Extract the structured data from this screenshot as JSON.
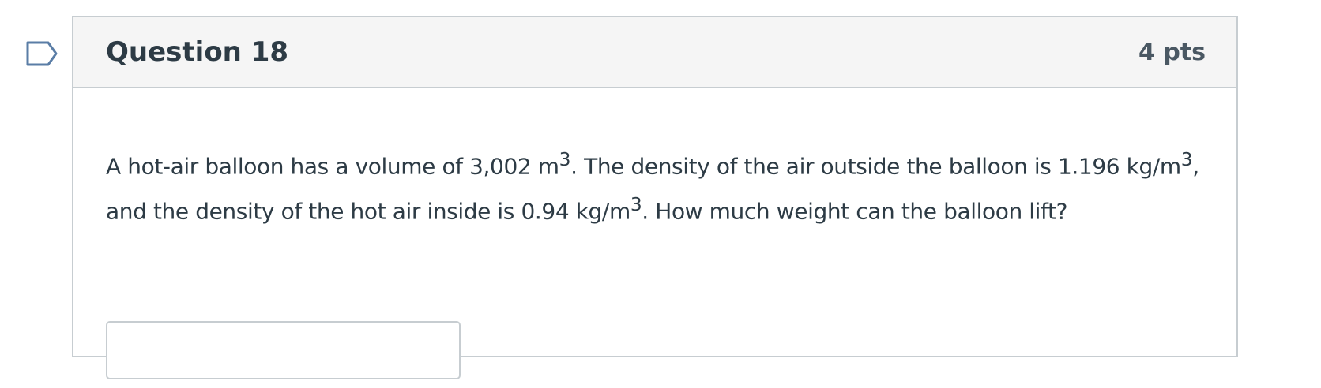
{
  "question": {
    "flag_icon": "bookmark-flag-icon",
    "title": "Question 18",
    "points": "4 pts",
    "text_parts": {
      "p1": "A hot-air balloon has a volume of 3,002 m",
      "sup1": "3",
      "p2": ". The density of the air outside the balloon is 1.196 kg/m",
      "sup2": "3",
      "p3": ", and the density of the hot air inside is 0.94 kg/m",
      "sup3": "3",
      "p4": ". How much weight can the balloon lift?"
    },
    "answer": {
      "value": "",
      "placeholder": ""
    }
  },
  "colors": {
    "border": "#c7cdd1",
    "header_bg": "#f5f5f5",
    "text": "#2d3b45",
    "flag": "#5a7da6"
  }
}
